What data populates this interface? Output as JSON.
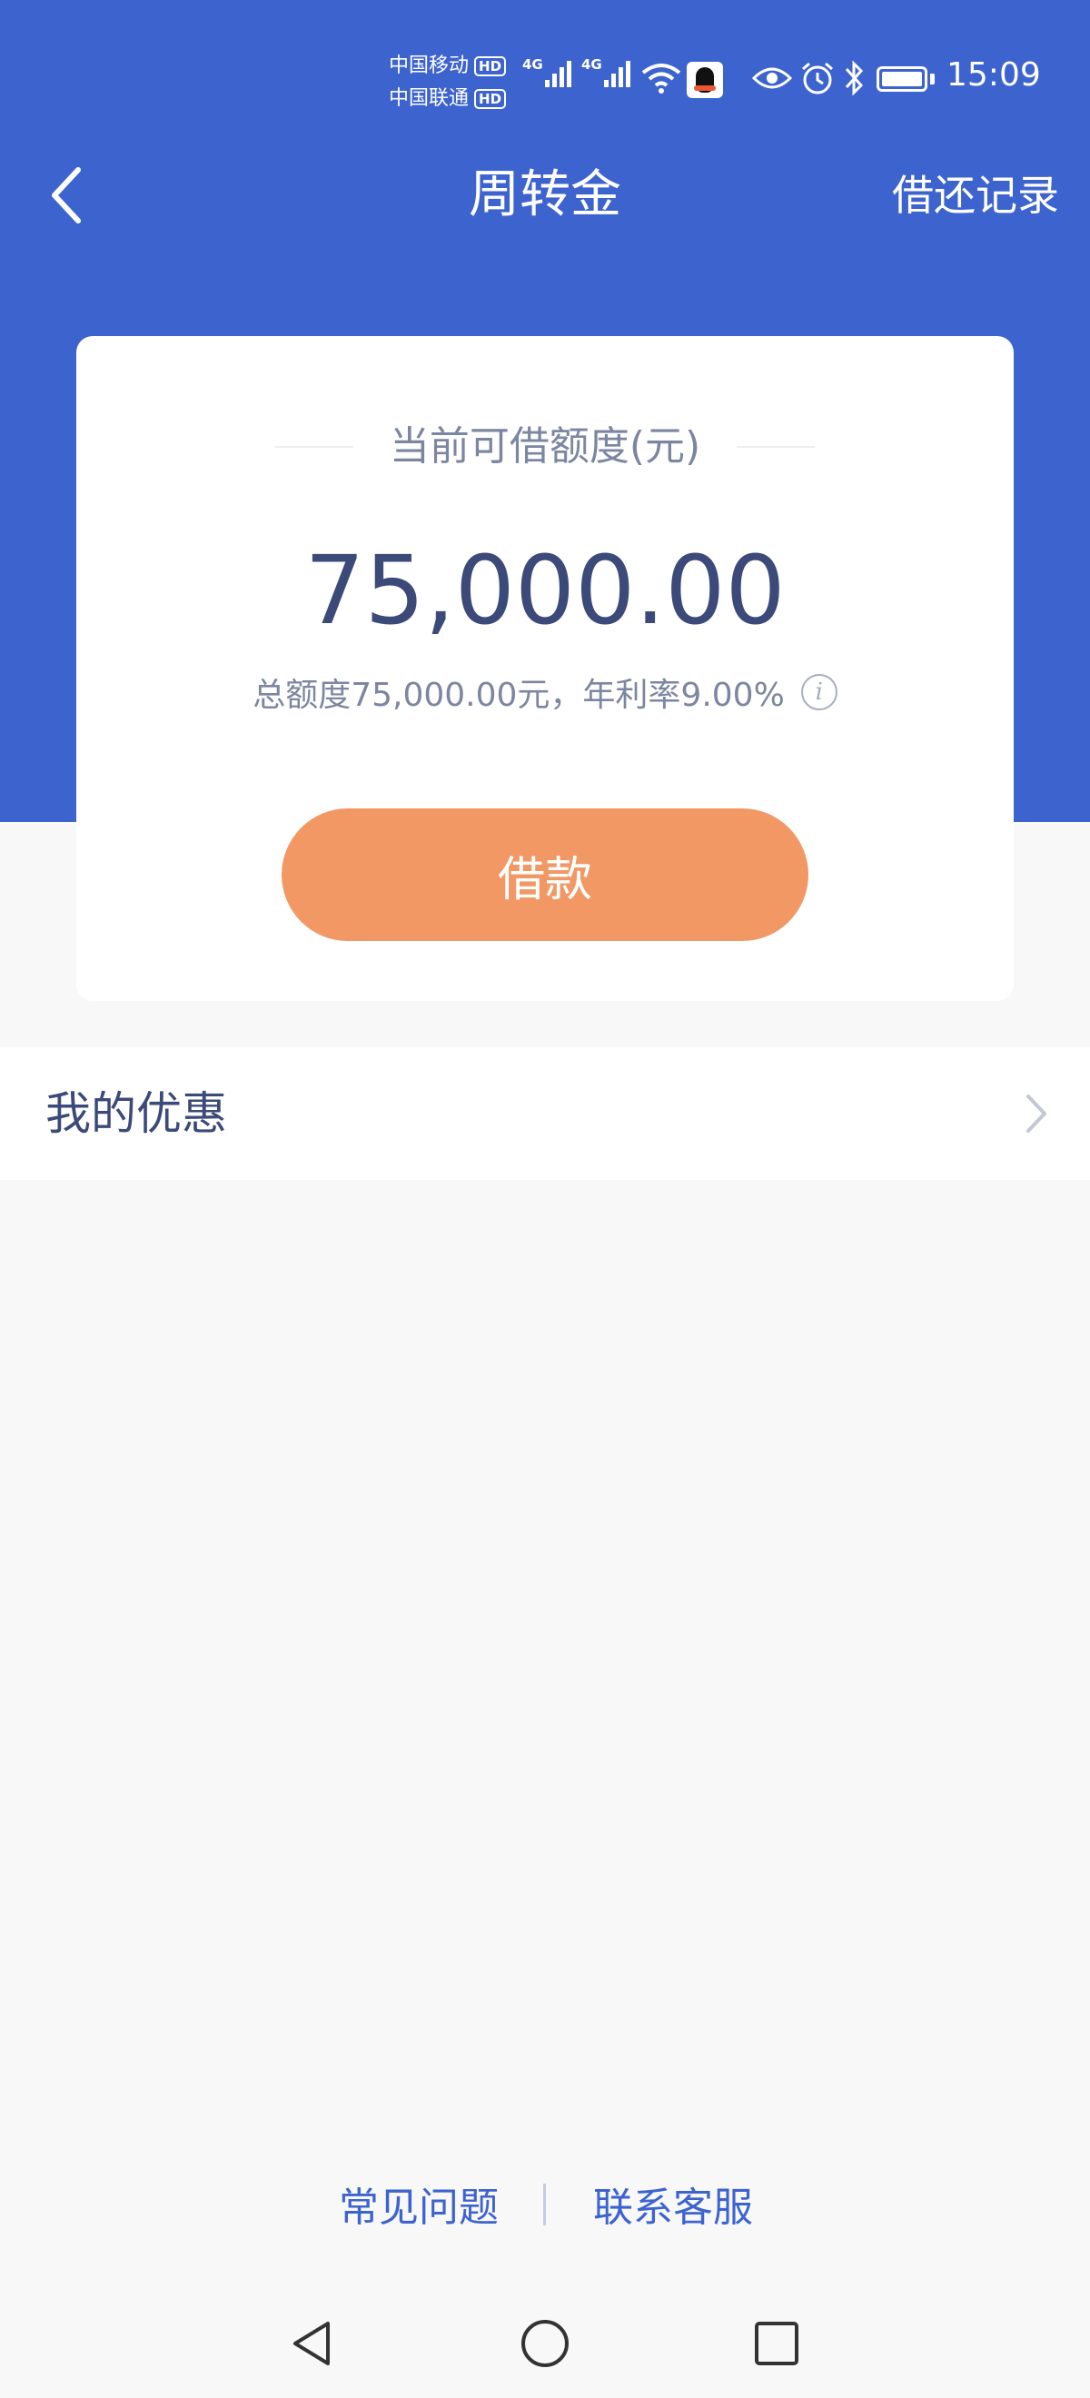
{
  "status_bar": {
    "carrier1": "中国移动",
    "carrier2": "中国联通",
    "hd_label": "HD",
    "network_label": "4G",
    "time": "15:09"
  },
  "nav": {
    "title": "周转金",
    "right_action": "借还记录"
  },
  "card": {
    "label": "当前可借额度(元)",
    "amount": "75,000.00",
    "total_info": "总额度75,000.00元，年利率9.00%",
    "info_icon_glyph": "i",
    "borrow_button": "借款"
  },
  "promo": {
    "label": "我的优惠"
  },
  "footer": {
    "faq": "常见问题",
    "contact": "联系客服"
  },
  "colors": {
    "header_blue": "#3d63ce",
    "button_orange": "#f29865",
    "text_navy": "#3b4a78",
    "text_gray": "#7d86a0",
    "link_blue": "#3d63ce"
  }
}
